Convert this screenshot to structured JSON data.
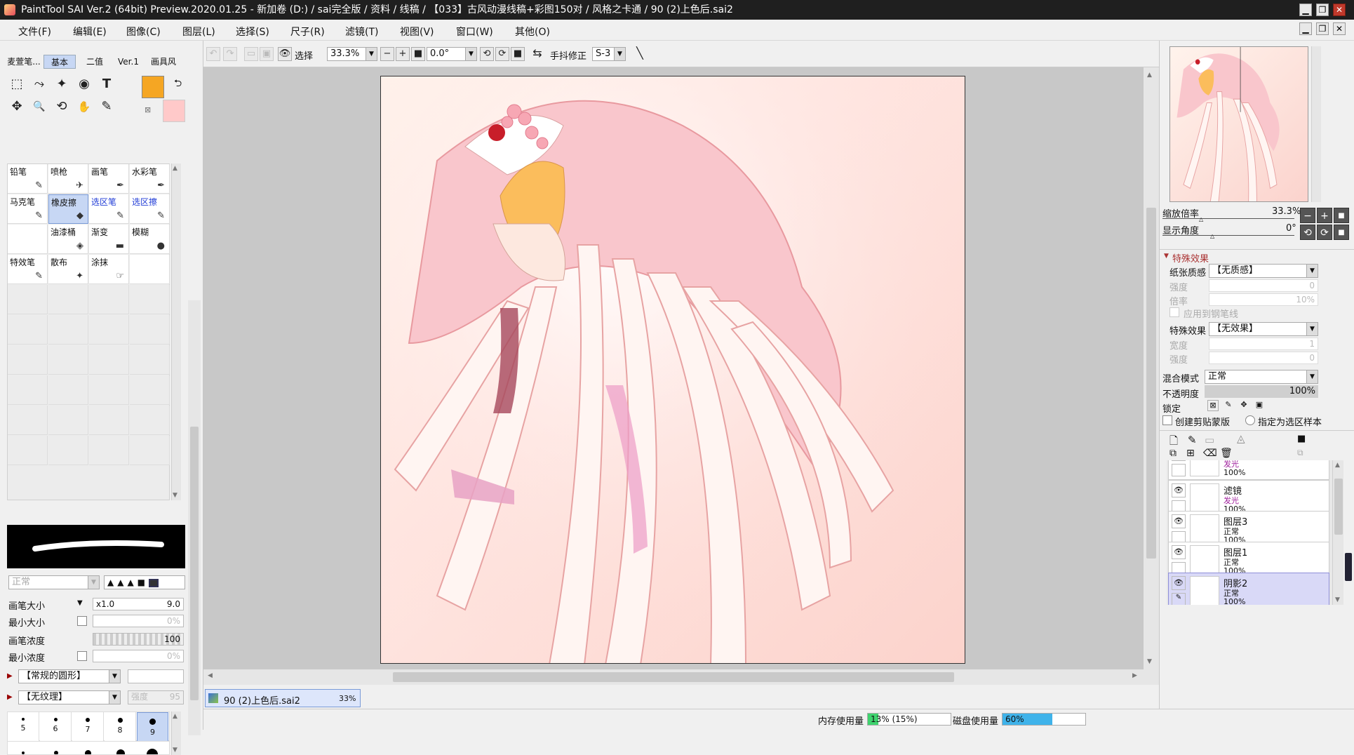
{
  "window": {
    "title": "PaintTool SAI Ver.2 (64bit) Preview.2020.01.25 - 新加卷 (D:) / sai完全版 / 资料 / 线稿 / 【033】古风动漫线稿+彩图150对 / 风格之卡通 / 90 (2)上色后.sai2",
    "controls": [
      "▁",
      "❐",
      "✕"
    ]
  },
  "menu": [
    "文件(F)",
    "编辑(E)",
    "图像(C)",
    "图层(L)",
    "选择(S)",
    "尺子(R)",
    "滤镜(T)",
    "视图(V)",
    "窗口(W)",
    "其他(O)"
  ],
  "left": {
    "tabs": [
      "麦萱笔...",
      "基本",
      "二值",
      "Ver.1",
      "画具风"
    ],
    "active_tab": "基本",
    "tools": [
      "⬚",
      "⤳",
      "✦",
      "◉",
      "T",
      "✥",
      "🔍",
      "⟲",
      "✋",
      "✎"
    ],
    "primary_color": "#f5a623",
    "secondary_color": "#ffc9c9",
    "brushes": [
      {
        "name": "铅笔",
        "icon": "✎",
        "blue": false,
        "selected": false
      },
      {
        "name": "喷枪",
        "icon": "✈",
        "blue": false,
        "selected": false
      },
      {
        "name": "画笔",
        "icon": "✒",
        "blue": false,
        "selected": false
      },
      {
        "name": "水彩笔",
        "icon": "✒",
        "blue": false,
        "selected": false
      },
      {
        "name": "马克笔",
        "icon": "✎",
        "blue": false,
        "selected": false
      },
      {
        "name": "橡皮擦",
        "icon": "◆",
        "blue": false,
        "selected": true
      },
      {
        "name": "选区笔",
        "icon": "✎",
        "blue": true,
        "selected": false
      },
      {
        "name": "选区擦",
        "icon": "✎",
        "blue": true,
        "selected": false
      },
      {
        "name": "",
        "icon": "",
        "blue": false,
        "selected": false
      },
      {
        "name": "油漆桶",
        "icon": "◈",
        "blue": false,
        "selected": false
      },
      {
        "name": "渐变",
        "icon": "▬",
        "blue": false,
        "selected": false
      },
      {
        "name": "模糊",
        "icon": "●",
        "blue": false,
        "selected": false
      },
      {
        "name": "特效笔",
        "icon": "✎",
        "blue": false,
        "selected": false
      },
      {
        "name": "散布",
        "icon": "✦",
        "blue": false,
        "selected": false
      },
      {
        "name": "涂抹",
        "icon": "☞",
        "blue": false,
        "selected": false
      },
      {
        "name": "",
        "icon": "",
        "blue": false,
        "selected": false
      }
    ],
    "blend_mode": "正常",
    "brush_size_label": "画笔大小",
    "brush_size_mult": "x1.0",
    "brush_size_value": "9.0",
    "min_size_label": "最小大小",
    "min_size_value": "0%",
    "density_label": "画笔浓度",
    "density_value": "100",
    "min_density_label": "最小浓度",
    "min_density_value": "0%",
    "shape_dd": "【常规的圆形】",
    "texture_dd": "【无纹理】",
    "texture_strength_label": "强度",
    "texture_strength_value": "95",
    "sizes": [
      "5",
      "6",
      "7",
      "8",
      "9"
    ],
    "selected_size": "9"
  },
  "toolbar": {
    "select_label": "选择",
    "zoom": "33.3%",
    "angle": "0.0°",
    "stabilizer_label": "手抖修正",
    "stabilizer_value": "S-3"
  },
  "doc_tab": {
    "name": "90 (2)上色后.sai2",
    "zoom": "33%"
  },
  "right": {
    "zoom_label": "缩放倍率",
    "zoom_value": "33.3%",
    "angle_label": "显示角度",
    "angle_value": "0°",
    "effects_header": "特殊效果",
    "paper_label": "纸张质感",
    "paper_value": "【无质感】",
    "strength_label": "强度",
    "strength_value": "0",
    "rate_label": "倍率",
    "rate_value": "10%",
    "apply_line_label": "应用到钢笔线",
    "effect_label": "特殊效果",
    "effect_value": "【无效果】",
    "width_label": "宽度",
    "width_value": "1",
    "strength2_label": "强度",
    "strength2_value": "0",
    "blend_label": "混合模式",
    "blend_value": "正常",
    "opacity_label": "不透明度",
    "opacity_value": "100%",
    "lock_label": "锁定",
    "clip_label": "创建剪贴蒙版",
    "sample_label": "指定为选区样本",
    "layers": [
      {
        "name": "",
        "mode": "发光",
        "opacity": "100%",
        "selected": false
      },
      {
        "name": "滤镜",
        "mode": "发光",
        "opacity": "100%",
        "selected": false
      },
      {
        "name": "图层3",
        "mode": "正常",
        "opacity": "100%",
        "selected": false
      },
      {
        "name": "图层1",
        "mode": "正常",
        "opacity": "100%",
        "selected": false
      },
      {
        "name": "阴影2",
        "mode": "正常",
        "opacity": "100%",
        "selected": true
      }
    ]
  },
  "status": {
    "mem_label": "内存使用量",
    "mem_value": "13% (15%)",
    "mem_fraction": 0.13,
    "disk_label": "磁盘使用量",
    "disk_value": "60%",
    "disk_fraction": 0.6
  }
}
